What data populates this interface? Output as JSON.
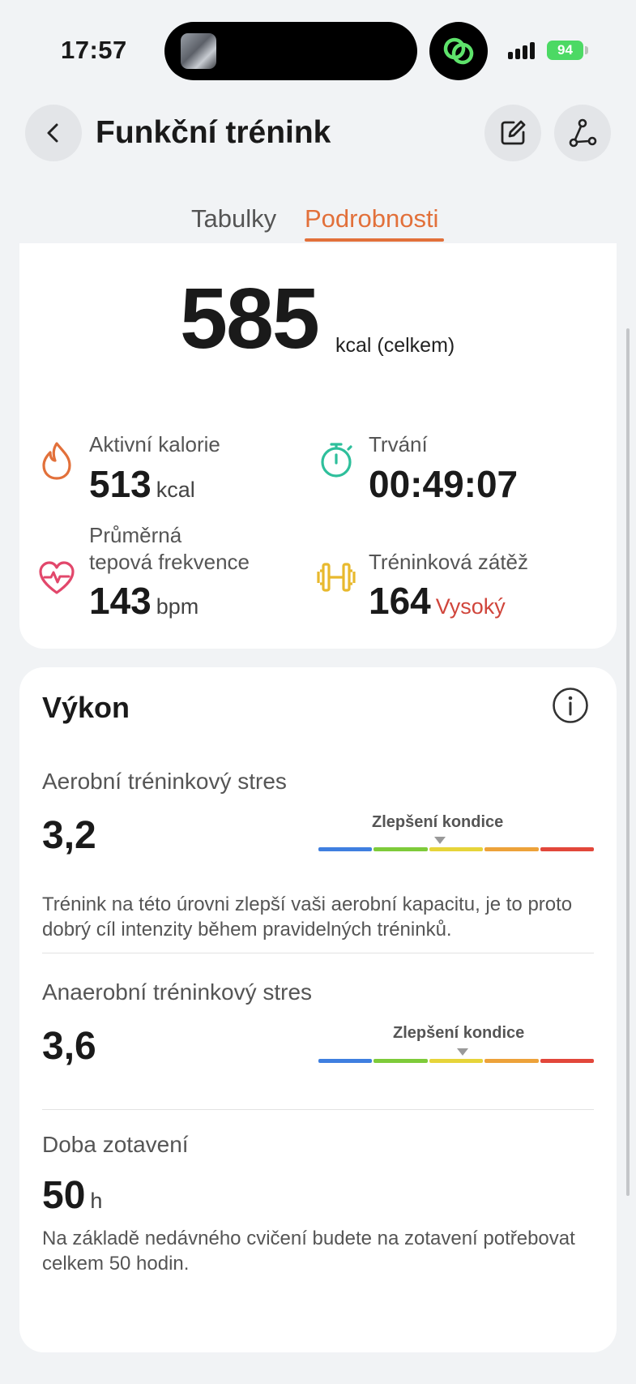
{
  "status_bar": {
    "time": "17:57",
    "battery": "94"
  },
  "header": {
    "title": "Funkční trénink"
  },
  "tabs": [
    {
      "label": "Tabulky",
      "active": false
    },
    {
      "label": "Podrobnosti",
      "active": true
    }
  ],
  "summary": {
    "total_value": "585",
    "total_unit": "kcal (celkem)",
    "stats": {
      "active_calories": {
        "label": "Aktivní kalorie",
        "value": "513",
        "unit": "kcal"
      },
      "duration": {
        "label": "Trvání",
        "value": "00:49:07"
      },
      "heart_rate": {
        "label_line1": "Průměrná",
        "label_line2": "tepová frekvence",
        "value": "143",
        "unit": "bpm"
      },
      "training_load": {
        "label": "Tréninková zátěž",
        "value": "164",
        "level": "Vysoký"
      }
    }
  },
  "performance": {
    "title": "Výkon",
    "aerobic": {
      "label": "Aerobní tréninkový stres",
      "value": "3,2",
      "scale_label": "Zlepšení kondice",
      "description": "Trénink na této úrovni zlepší vaši aerobní kapacitu, je to proto dobrý cíl intenzity během pravidelných tréninků."
    },
    "anaerobic": {
      "label": "Anaerobní tréninkový stres",
      "value": "3,6",
      "scale_label": "Zlepšení kondice"
    },
    "recovery": {
      "label": "Doba zotavení",
      "value": "50",
      "unit": "h",
      "description": "Na základě nedávného cvičení budete na zotavení potřebovat celkem 50 hodin."
    }
  },
  "colors": {
    "accent": "#e2703a",
    "level_high": "#d0453b",
    "scale": [
      "#3f7fe0",
      "#7ecb3a",
      "#e6d43a",
      "#eda23a",
      "#e2473b"
    ]
  },
  "icons": [
    "back-icon",
    "edit-icon",
    "route-icon",
    "flame-icon",
    "stopwatch-icon",
    "heart-rate-icon",
    "dumbbell-icon",
    "info-icon"
  ]
}
